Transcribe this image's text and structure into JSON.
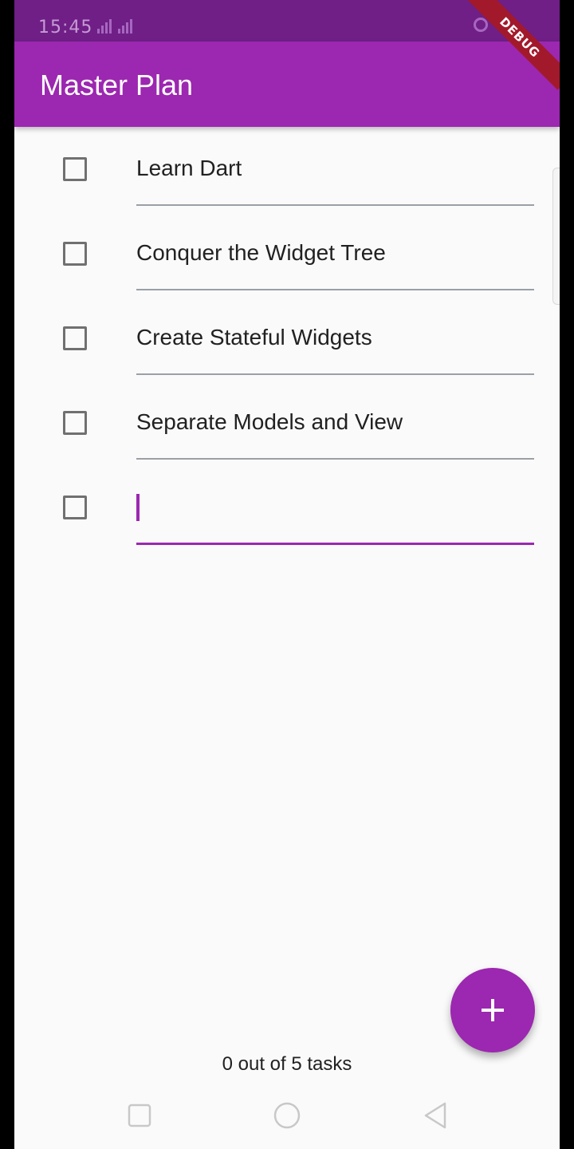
{
  "status_bar": {
    "time": "15:45"
  },
  "app_bar": {
    "title": "Master Plan",
    "debug_label": "DEBUG",
    "color": "#9c27b0"
  },
  "tasks": [
    {
      "description": "Learn Dart",
      "complete": false
    },
    {
      "description": "Conquer the Widget Tree",
      "complete": false
    },
    {
      "description": "Create Stateful Widgets",
      "complete": false
    },
    {
      "description": "Separate Models and View",
      "complete": false
    },
    {
      "description": "",
      "complete": false
    }
  ],
  "fab": {
    "icon": "plus-icon"
  },
  "footer": {
    "progress_text": "0 out of 5 tasks"
  },
  "nav_bar": {
    "icons": [
      "recents-square-icon",
      "home-circle-icon",
      "back-triangle-icon"
    ]
  }
}
